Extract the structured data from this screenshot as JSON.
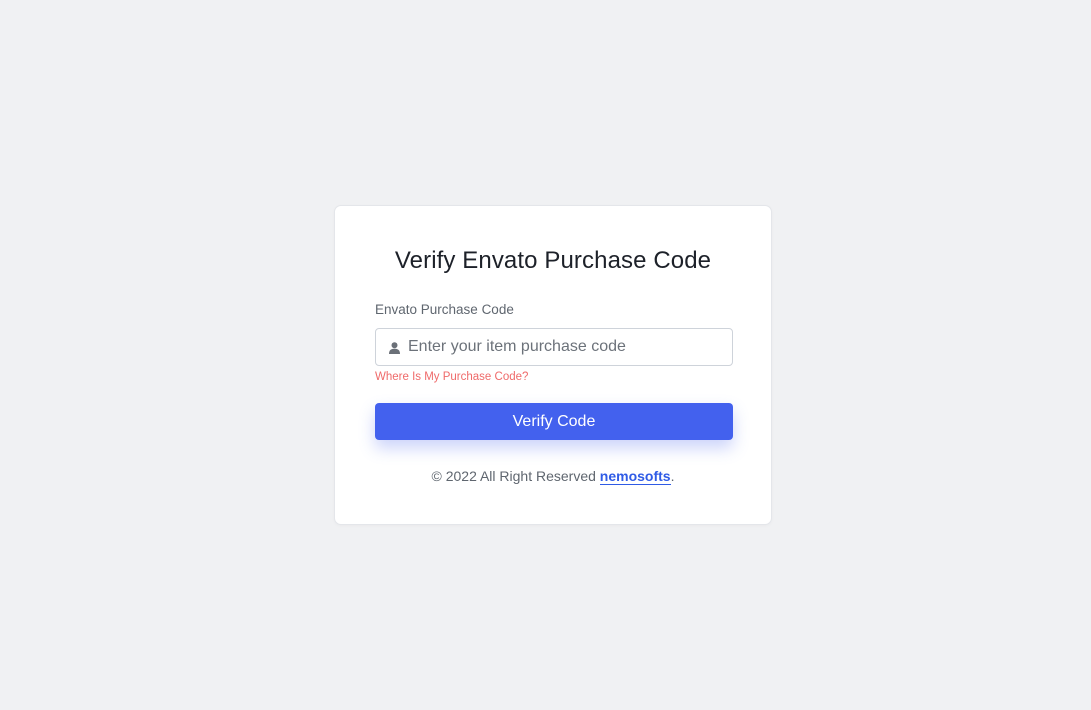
{
  "card": {
    "title": "Verify Envato Purchase Code",
    "field_label": "Envato Purchase Code",
    "input": {
      "placeholder": "Enter your item purchase code",
      "value": "",
      "icon": "user-icon"
    },
    "help_link": "Where Is My Purchase Code?",
    "button_label": "Verify Code",
    "footer": {
      "text": "© 2022 All Right Reserved ",
      "brand": "nemosofts",
      "suffix": "."
    }
  },
  "colors": {
    "page_background": "#f0f1f3",
    "card_background": "#ffffff",
    "button": "#4361ee",
    "help_link": "#ef6a6a",
    "brand_link": "#2f5be6"
  }
}
